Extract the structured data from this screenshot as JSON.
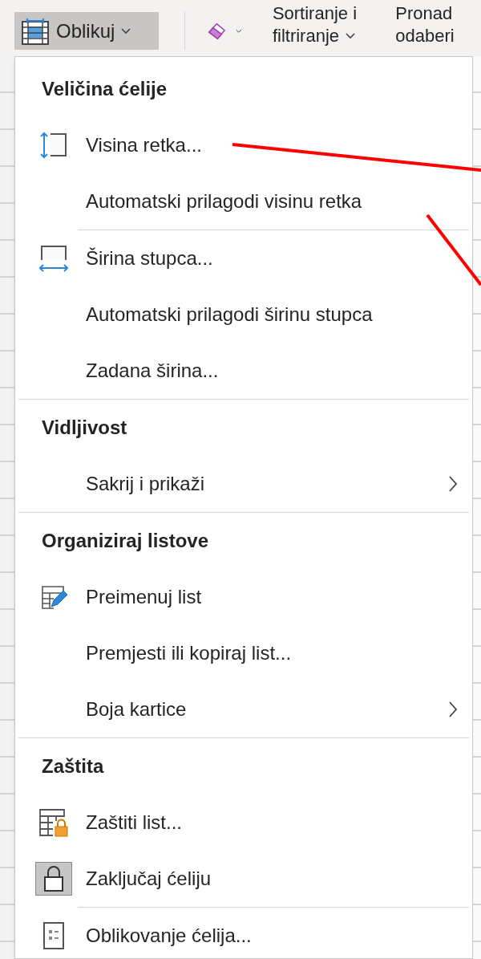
{
  "ribbon": {
    "buttons": [
      {
        "kind": "format",
        "label": "Oblikuj",
        "selected": true
      },
      {
        "kind": "clear",
        "selected": false
      },
      {
        "kind": "sort",
        "lines": [
          "Sortiranje i",
          "filtriranje"
        ],
        "selected": false
      },
      {
        "kind": "find",
        "lines": [
          "Pronad",
          "odaberi"
        ],
        "selected": false
      }
    ]
  },
  "menu": {
    "sections": [
      {
        "title": "Veličina ćelije",
        "groups": [
          [
            {
              "label": "Visina retka..."
            },
            {
              "label": "Automatski prilagodi visinu retka"
            }
          ],
          [
            {
              "label": "Širina stupca..."
            },
            {
              "label": "Automatski prilagodi širinu stupca"
            },
            {
              "label": "Zadana širina..."
            }
          ]
        ]
      },
      {
        "title": "Vidljivost",
        "groups": [
          [
            {
              "label": "Sakrij i prikaži",
              "submenu": true
            }
          ]
        ]
      },
      {
        "title": "Organiziraj listove",
        "groups": [
          [
            {
              "label": "Preimenuj list"
            },
            {
              "label": "Premjesti ili kopiraj list..."
            },
            {
              "label": "Boja kartice",
              "submenu": true
            }
          ]
        ]
      },
      {
        "title": "Zaštita",
        "groups": [
          [
            {
              "label": "Zaštiti list..."
            },
            {
              "label": "Zaključaj ćeliju",
              "checked": true
            }
          ],
          [
            {
              "label": "Oblikovanje ćelija..."
            }
          ]
        ]
      }
    ]
  },
  "annotation_lines": [
    {
      "color": "#ff0000"
    },
    {
      "color": "#ff0000"
    }
  ]
}
